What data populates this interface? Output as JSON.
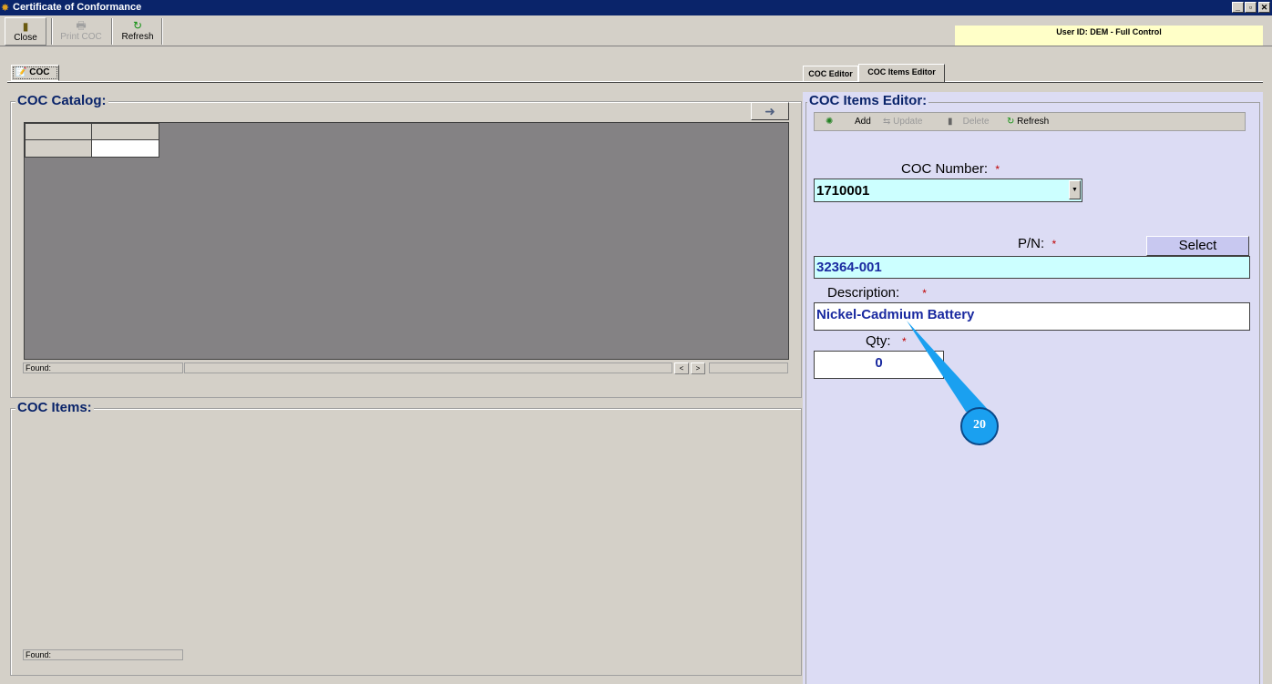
{
  "window": {
    "title": "Certificate of Conformance"
  },
  "toolbar": {
    "close": "Close",
    "print": "Print COC",
    "refresh": "Refresh"
  },
  "user": "User ID: DEM - Full Control",
  "main_tab": "COC",
  "right_tabs": [
    "COC Editor",
    "COC Items Editor"
  ],
  "catalog": {
    "title": "COC Catalog:",
    "found": "Found:"
  },
  "items": {
    "title": "COC Items:",
    "found": "Found:"
  },
  "editor": {
    "title": "COC Items Editor:",
    "toolbar": {
      "add": "Add",
      "update": "Update",
      "delete": "Delete",
      "refresh": "Refresh"
    },
    "coc_number_label": "COC Number:",
    "coc_number": "1710001",
    "pn_label": "P/N:",
    "pn": "32364-001",
    "select": "Select",
    "description_label": "Description:",
    "description": "Nickel-Cadmium Battery",
    "qty_label": "Qty:",
    "qty": "0",
    "required": "*"
  },
  "callout": "20"
}
